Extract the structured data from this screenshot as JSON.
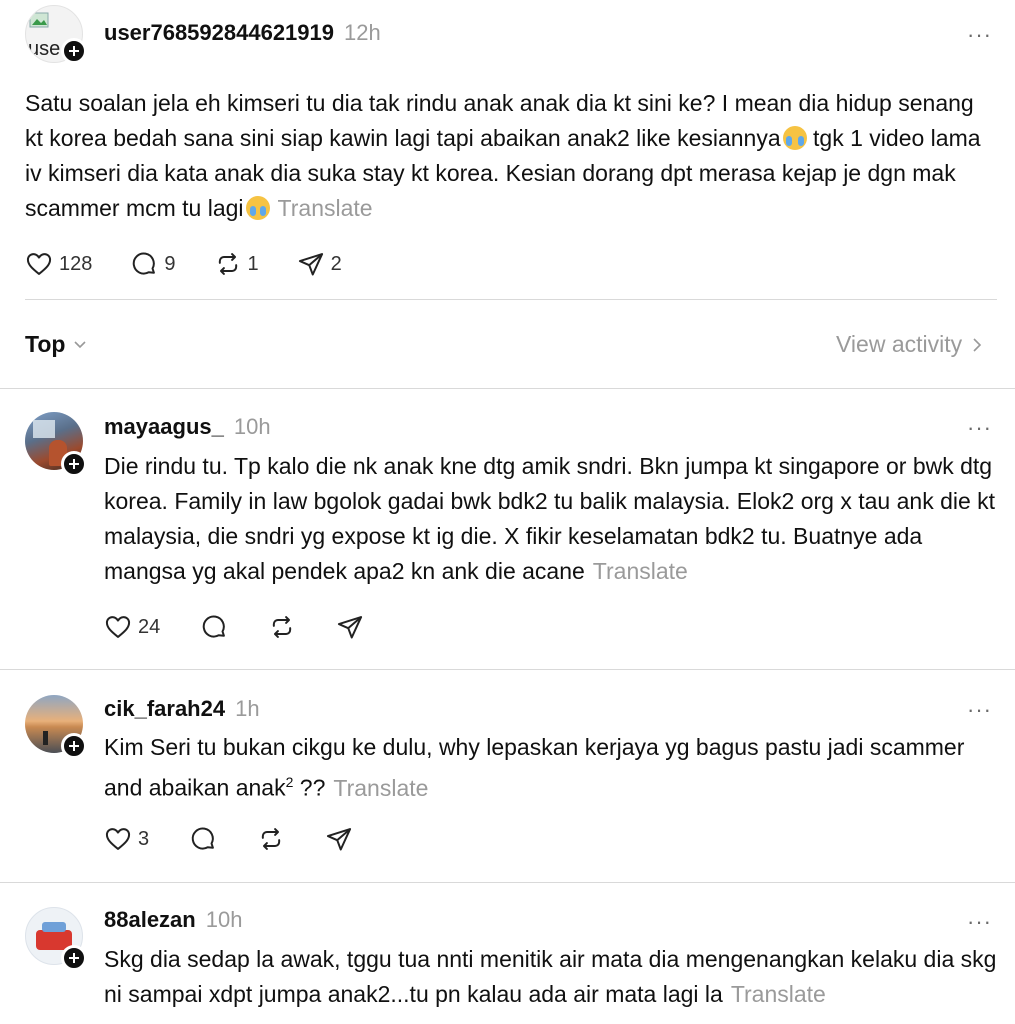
{
  "post": {
    "username": "user768592844621919",
    "time": "12h",
    "avatar_text": "use",
    "text_main": "Satu soalan jela eh kimseri tu dia tak rindu anak anak dia kt sini ke? I mean dia hidup senang kt korea bedah sana sini siap kawin lagi tapi abaikan anak2 like kesiannya",
    "text_cont": " tgk 1 video lama iv kimseri dia kata anak dia suka stay kt korea. Kesian dorang dpt merasa kejap je dgn mak scammer mcm tu lagi",
    "translate": "Translate",
    "likes": "128",
    "replies": "9",
    "reposts": "1",
    "shares": "2"
  },
  "sort": {
    "label": "Top",
    "view_activity": "View activity"
  },
  "comments": [
    {
      "username": "mayaagus_",
      "time": "10h",
      "text": "Die rindu tu. Tp kalo die nk anak kne dtg amik sndri. Bkn jumpa kt singapore or bwk dtg korea. Family in law bgolok gadai bwk bdk2 tu balik malaysia. Elok2 org x tau ank die kt malaysia, die sndri yg expose kt ig die. X fikir keselamatan bdk2 tu. Buatnye ada mangsa yg akal pendek apa2 kn ank die acane",
      "translate": "Translate",
      "likes": "24"
    },
    {
      "username": "cik_farah24",
      "time": "1h",
      "text": "Kim Seri tu bukan cikgu ke dulu, why lepaskan kerjaya yg bagus pastu jadi scammer and abaikan anak",
      "sup": "2",
      "text_tail": " ??",
      "translate": "Translate",
      "likes": "3"
    },
    {
      "username": "88alezan",
      "time": "10h",
      "text": "Skg dia sedap la awak, tggu tua nnti menitik air mata dia mengenangkan kelaku dia skg ni sampai xdpt jumpa anak2...tu pn kalau ada air mata lagi la",
      "translate": "Translate"
    }
  ],
  "icons": {
    "like": "heart-icon",
    "reply": "comment-icon",
    "repost": "repost-icon",
    "share": "send-icon",
    "more": "more-icon",
    "follow": "plus-icon"
  },
  "more_label": "···"
}
